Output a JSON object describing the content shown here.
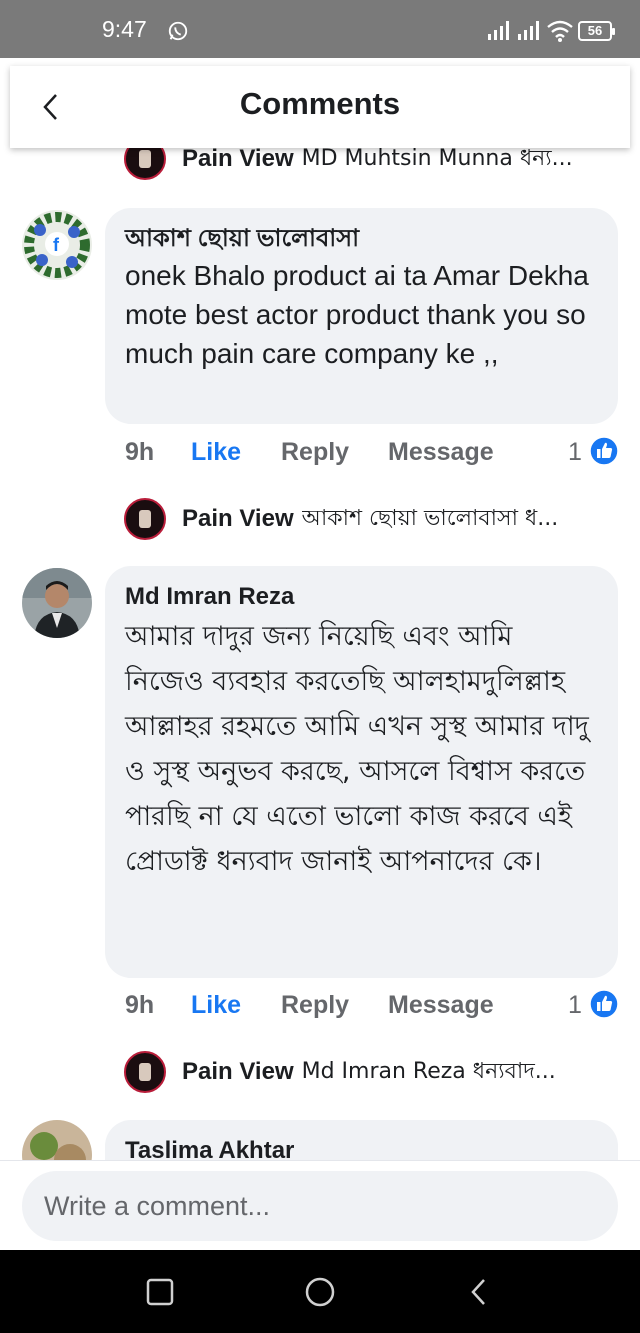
{
  "status_bar": {
    "time": "9:47",
    "battery": "56"
  },
  "header": {
    "title": "Comments"
  },
  "comments_partial_top": {
    "name": "Pain View",
    "text": "MD Muhtsin Munna ধন্য..."
  },
  "comments": [
    {
      "author": "আকাশ ছোয়া ভালোবাসা",
      "text": "onek Bhalo  product ai ta Amar Dekha mote best actor product thank you  so much pain care company ke ,,",
      "time": "9h",
      "like_label": "Like",
      "reply_label": "Reply",
      "message_label": "Message",
      "reactions": "1",
      "reply_preview": {
        "name": "Pain View",
        "text": "আকাশ ছোয়া ভালোবাসা ধ..."
      }
    },
    {
      "author": "Md Imran Reza",
      "text": "আমার দাদুর জন্য নিয়েছি এবং আমি নিজেও ব্যবহার করতেছি আলহামদুলিল্লাহ আল্লাহর রহমতে আমি এখন সুস্থ  আমার  দাদু ও সুস্থ অনুভব করছে, আসলে বিশ্বাস করতে পারছি না যে এতো ভালো কাজ করবে এই প্রোডাক্ট ধন্যবাদ জানাই আপনাদের কে।",
      "time": "9h",
      "like_label": "Like",
      "reply_label": "Reply",
      "message_label": "Message",
      "reactions": "1",
      "reply_preview": {
        "name": "Pain View",
        "text": "Md Imran Reza ধন্যবাদ..."
      }
    },
    {
      "author": "Taslima Akhtar"
    }
  ],
  "composer": {
    "placeholder": "Write a comment..."
  },
  "colors": {
    "accent": "#1877f2",
    "bubble": "#f0f2f5",
    "muted": "#65676b",
    "status_bar": "#7a7a7a"
  },
  "icons": [
    "whatsapp-icon",
    "signal-icon",
    "wifi-icon",
    "battery-icon",
    "back-icon",
    "like-reaction-icon",
    "recents-icon",
    "home-icon",
    "nav-back-icon"
  ]
}
